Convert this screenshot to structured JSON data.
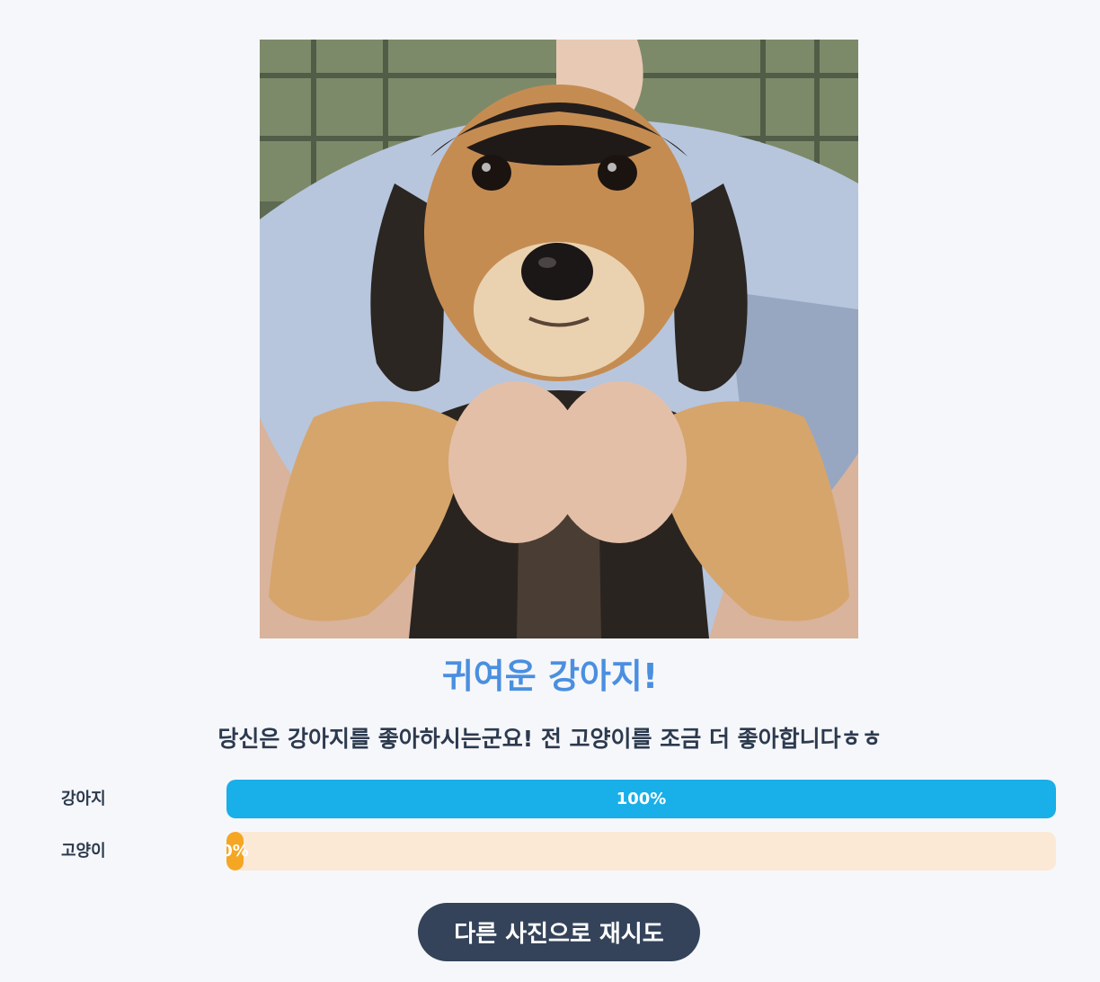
{
  "result": {
    "photo_subject": "dog-photo",
    "title": "귀여운 강아지!",
    "description": "당신은 강아지를 좋아하시는군요! 전 고양이를 조금 더 좋아합니다ㅎㅎ"
  },
  "bars": [
    {
      "label": "강아지",
      "percent_text": "100%",
      "value": 1.0,
      "fill_color": "#19afe8",
      "track_color": "#d8eef9"
    },
    {
      "label": "고양이",
      "percent_text": "0%",
      "value": 0.0,
      "fill_color": "#f5a623",
      "track_color": "#fbe9d6"
    }
  ],
  "retry_button": {
    "label": "다른 사진으로 재시도"
  },
  "colors": {
    "background": "#f6f7fa",
    "title": "#4a8fe0",
    "text": "#2c3a4f",
    "button": "#34435a"
  }
}
